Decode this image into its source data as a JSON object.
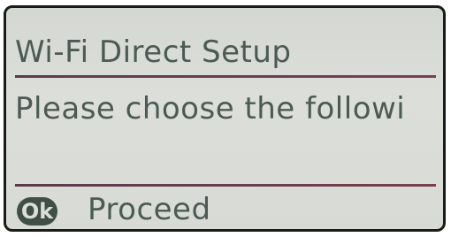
{
  "screen": {
    "title": "Wi-Fi Direct Setup",
    "message": "Please choose the followi",
    "footer": {
      "ok_button_label": "Ok",
      "proceed_label": "Proceed"
    }
  },
  "colors": {
    "lcd_background": "#d8dbd5",
    "lcd_text": "#4b5a52",
    "rule": "#6a3d50",
    "ok_badge": "#3f4f46"
  }
}
